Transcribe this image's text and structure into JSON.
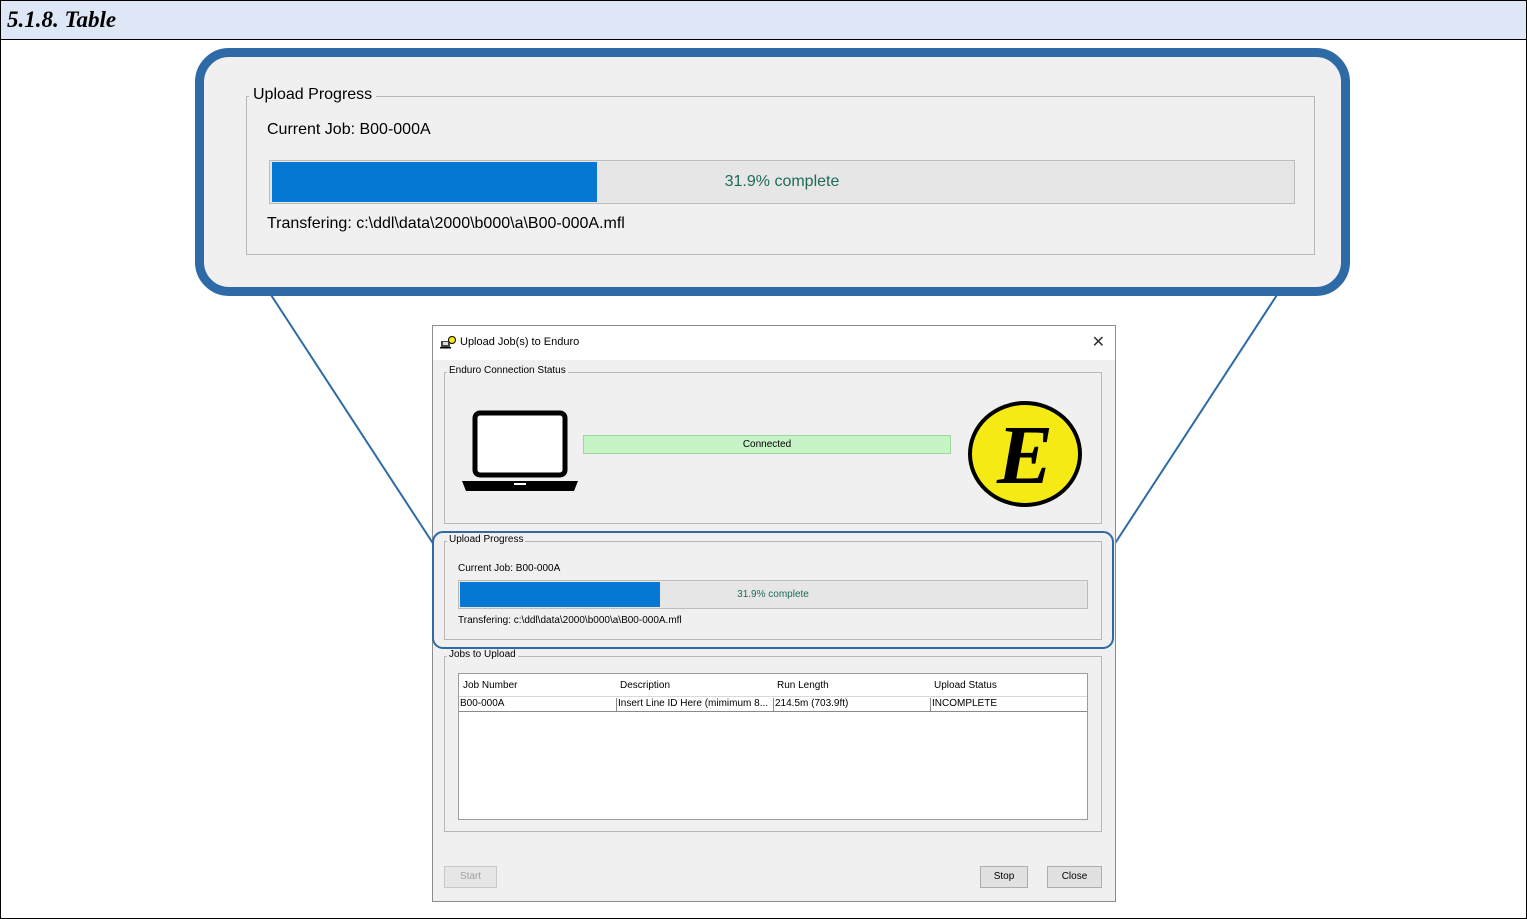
{
  "section": {
    "title": "5.1.8. Table"
  },
  "zoom": {
    "legend": "Upload Progress",
    "current_job": "Current Job:  B00-000A",
    "progress_text": "31.9% complete",
    "progress_fraction": 0.319,
    "transfering": "Transfering: c:\\ddl\\data\\2000\\b000\\a\\B00-000A.mfl"
  },
  "dialog": {
    "title": "Upload Job(s) to Enduro",
    "connection": {
      "legend": "Enduro Connection Status",
      "status": "Connected",
      "logo_letter": "E"
    },
    "progress": {
      "legend": "Upload Progress",
      "current_job": "Current Job:  B00-000A",
      "progress_text": "31.9% complete",
      "progress_fraction": 0.319,
      "transfering": "Transfering: c:\\ddl\\data\\2000\\b000\\a\\B00-000A.mfl"
    },
    "jobs": {
      "legend": "Jobs to Upload",
      "columns": [
        "Job Number",
        "Description",
        "Run Length",
        "Upload Status"
      ],
      "rows": [
        [
          "B00-000A",
          "Insert Line ID Here (mimimum 8...",
          "214.5m (703.9ft)",
          "INCOMPLETE"
        ]
      ]
    },
    "buttons": {
      "start": "Start",
      "stop": "Stop",
      "close": "Close"
    }
  },
  "colors": {
    "progress_fill": "#0678d4",
    "connected": "#c6f4c6",
    "callout_border": "#2e6aa6",
    "logo_yellow": "#f5ea14"
  },
  "icons": [
    "laptop-icon",
    "enduro-logo",
    "app-icon",
    "close-icon"
  ]
}
